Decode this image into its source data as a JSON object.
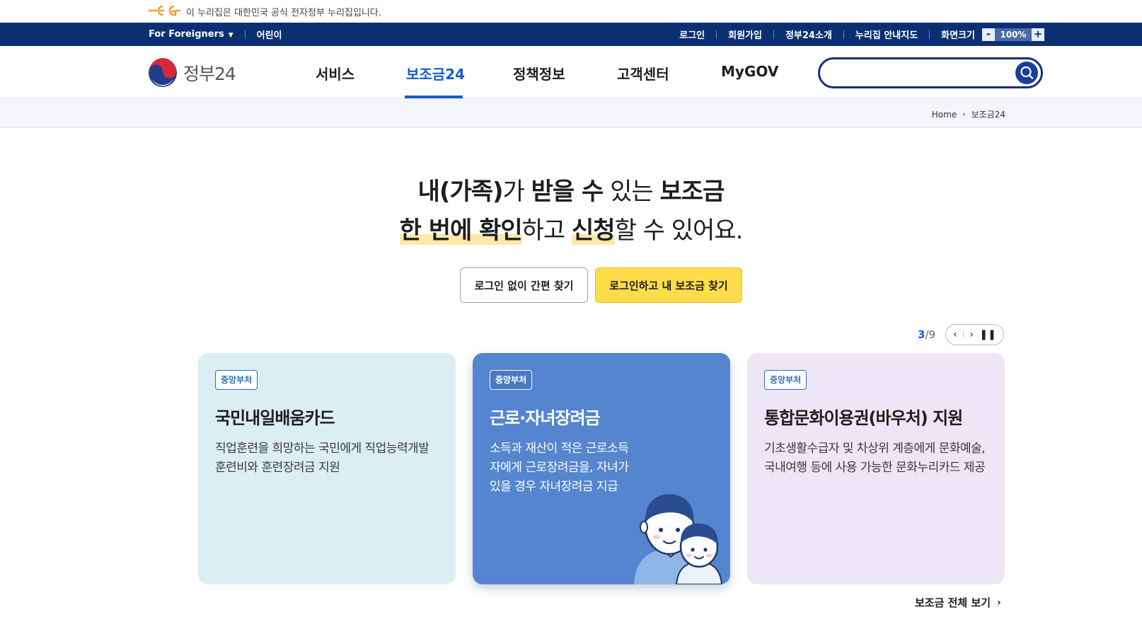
{
  "official_banner": {
    "text": "이 누리집은 대한민국 공식 전자정부 누리집입니다."
  },
  "utility": {
    "foreigners": "For Foreigners",
    "kids": "어린이",
    "links": [
      "로그인",
      "회원가입",
      "정부24소개",
      "누리집 안내지도"
    ],
    "zoom_label": "화면크기",
    "zoom_minus": "-",
    "zoom_value": "100%",
    "zoom_plus": "+"
  },
  "header": {
    "logo_text": "정부24",
    "nav": [
      "서비스",
      "보조금24",
      "정책정보",
      "고객센터",
      "MyGOV"
    ],
    "active_nav": "보조금24",
    "search_placeholder": ""
  },
  "breadcrumb": {
    "home": "Home",
    "current": "보조금24"
  },
  "hero": {
    "line1": [
      "내(가족)",
      "가 ",
      "받을 수",
      " 있는 ",
      "보조금"
    ],
    "line2": [
      "한 번에 확인",
      "하고 ",
      "신청",
      "할 수 있어요."
    ]
  },
  "buttons": {
    "guest": "로그인 없이 간편 찾기",
    "login": "로그인하고 내 보조금 찾기"
  },
  "carousel": {
    "current": "3",
    "total": "9",
    "separator": "/"
  },
  "cards": [
    {
      "badge": "중앙부처",
      "title": "국민내일배움카드",
      "desc": "직업훈련을 희망하는 국민에게 직업능력개발훈련비와 훈련장려금 지원"
    },
    {
      "badge": "중앙부처",
      "title": "근로·자녀장려금",
      "desc": "소득과 재산이 적은 근로소득자에게 근로장려금을, 자녀가 있을 경우 자녀장려금 지급"
    },
    {
      "badge": "중앙부처",
      "title": "통합문화이용권(바우처) 지원",
      "desc": "기초생활수급자 및 차상위 계층에게 문화예술, 국내여행 등에 사용 가능한 문화누리카드 제공"
    }
  ],
  "view_all": "보조금 전체 보기",
  "colors": {
    "navy": "#0b2f73",
    "accent_blue": "#1a5bcf",
    "yellow": "#ffdd4a"
  }
}
